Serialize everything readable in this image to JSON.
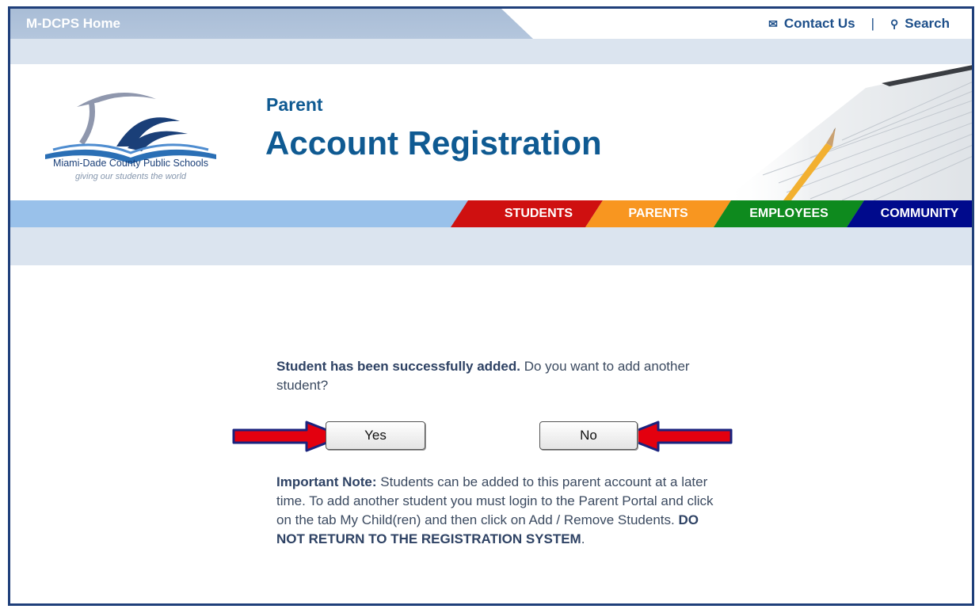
{
  "topbar": {
    "home_label": "M-DCPS Home",
    "contact_label": "Contact Us",
    "separator": "|",
    "search_label": "Search"
  },
  "logo": {
    "name": "Miami-Dade County Public Schools",
    "tagline": "giving our students the world"
  },
  "header": {
    "subtitle": "Parent",
    "title": "Account Registration"
  },
  "nav": {
    "students": "STUDENTS",
    "parents": "PARENTS",
    "employees": "EMPLOYEES",
    "community": "COMMUNITY"
  },
  "colors": {
    "students": "#cf1010",
    "parents": "#f89620",
    "employees": "#0e8a1e",
    "community": "#000a8c",
    "accent": "#0f5a92",
    "arrow": "#e3000f"
  },
  "message": {
    "bold": "Student has been successfully added.",
    "rest": " Do you want to add another student?"
  },
  "buttons": {
    "yes": "Yes",
    "no": "No"
  },
  "note": {
    "label": "Important Note:",
    "text": " Students can be added to this parent account at a later time. To add another student you must login to the Parent Portal and click on the tab My Child(ren) and then click on Add / Remove Students. ",
    "warning": "DO NOT RETURN TO THE REGISTRATION SYSTEM",
    "end": "."
  }
}
